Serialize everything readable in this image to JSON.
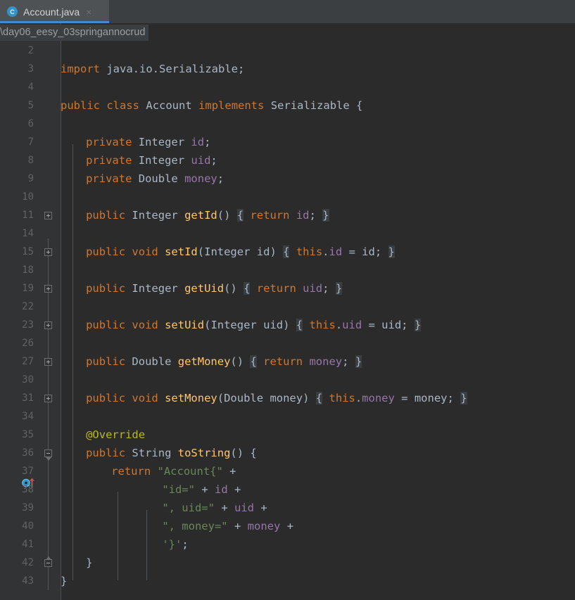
{
  "window": {
    "theme": "darcula",
    "background": "#2b2b2b"
  },
  "tab": {
    "icon": "java-class-icon",
    "icon_letter": "C",
    "title": "Account.java",
    "close_label": "×",
    "active_underline_color": "#4a88c7"
  },
  "path_tooltip": {
    "text": "\\day06_eesy_03springannocrud"
  },
  "editor": {
    "language": "java",
    "colors": {
      "background": "#2b2b2b",
      "gutter_background": "#313335",
      "keyword": "#cc7832",
      "field": "#9876aa",
      "method": "#ffc66d",
      "string": "#6a8759",
      "annotation": "#bbb529",
      "default_text": "#a9b7c6",
      "line_number": "#606366",
      "folded_region": "#3a3e41",
      "indent_guide": "#4f5254"
    },
    "lines": [
      {
        "no": "2",
        "text": ""
      },
      {
        "no": "3",
        "text": "    import java.io.Serializable;"
      },
      {
        "no": "4",
        "text": ""
      },
      {
        "no": "5",
        "text": "    public class Account implements Serializable {"
      },
      {
        "no": "6",
        "text": ""
      },
      {
        "no": "7",
        "text": "        private Integer id;"
      },
      {
        "no": "8",
        "text": "        private Integer uid;"
      },
      {
        "no": "9",
        "text": "        private Double money;"
      },
      {
        "no": "10",
        "text": ""
      },
      {
        "no": "11",
        "text": "        public Integer getId() { return id; }",
        "fold": "plus"
      },
      {
        "no": "14",
        "text": ""
      },
      {
        "no": "15",
        "text": "        public void setId(Integer id) { this.id = id; }",
        "fold": "plus"
      },
      {
        "no": "18",
        "text": ""
      },
      {
        "no": "19",
        "text": "        public Integer getUid() { return uid; }",
        "fold": "plus"
      },
      {
        "no": "22",
        "text": ""
      },
      {
        "no": "23",
        "text": "        public void setUid(Integer uid) { this.uid = uid; }",
        "fold": "plus"
      },
      {
        "no": "26",
        "text": ""
      },
      {
        "no": "27",
        "text": "        public Double getMoney() { return money; }",
        "fold": "plus"
      },
      {
        "no": "30",
        "text": ""
      },
      {
        "no": "31",
        "text": "        public void setMoney(Double money) { this.money = money; }",
        "fold": "plus"
      },
      {
        "no": "34",
        "text": ""
      },
      {
        "no": "35",
        "text": "        @Override"
      },
      {
        "no": "36",
        "text": "        public String toString() {",
        "fold": "region-start",
        "gutter_icon": "overriding-method-icon"
      },
      {
        "no": "37",
        "text": "            return \"Account{\" +"
      },
      {
        "no": "38",
        "text": "                    \"id=\" + id +"
      },
      {
        "no": "39",
        "text": "                    \", uid=\" + uid +"
      },
      {
        "no": "40",
        "text": "                    \", money=\" + money +"
      },
      {
        "no": "41",
        "text": "                    '}';"
      },
      {
        "no": "42",
        "text": "        }",
        "fold": "region-end"
      },
      {
        "no": "43",
        "text": "    }"
      }
    ]
  }
}
